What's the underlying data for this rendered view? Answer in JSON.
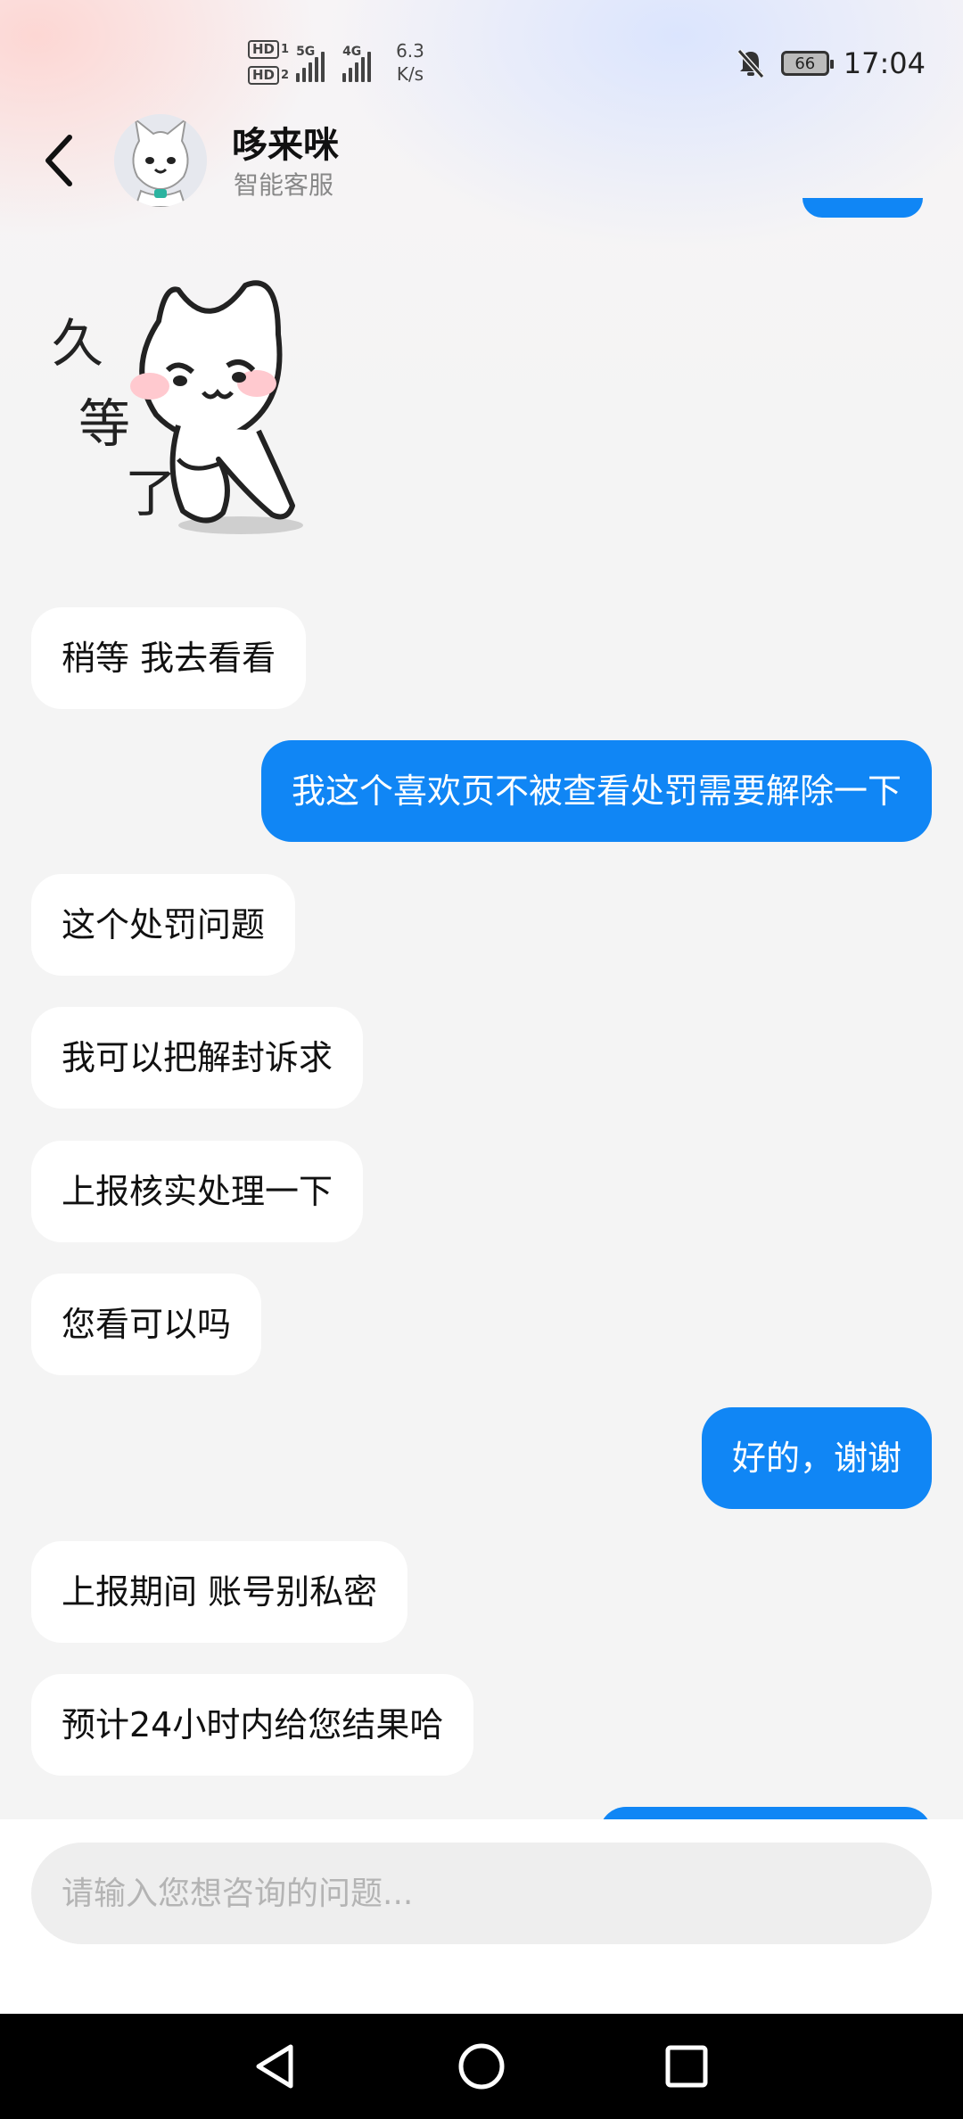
{
  "status_bar": {
    "sim1": "HD",
    "sim1_num": "1",
    "sim2": "HD",
    "sim2_num": "2",
    "net1": "5G",
    "net2": "4G",
    "speed_value": "6.3",
    "speed_unit": "K/s",
    "battery": "66",
    "time": "17:04",
    "icons": [
      "signal-5g-icon",
      "signal-4g-icon",
      "mute-bell-icon",
      "battery-icon"
    ]
  },
  "header": {
    "title": "哆来咪",
    "subtitle": "智能客服",
    "back_icon": "chevron-left-icon"
  },
  "chat": {
    "sticker": {
      "icon": "cat-waiting-sticker",
      "text_1": "久",
      "text_2": "等",
      "text_3": "了"
    },
    "messages": [
      {
        "side": "in",
        "text": "稍等 我去看看"
      },
      {
        "side": "out",
        "text": "我这个喜欢页不被查看处罚需要解除一下"
      },
      {
        "side": "in",
        "text": "这个处罚问题"
      },
      {
        "side": "in",
        "text": "我可以把解封诉求"
      },
      {
        "side": "in",
        "text": "上报核实处理一下"
      },
      {
        "side": "in",
        "text": "您看可以吗"
      },
      {
        "side": "out",
        "text": "好的，谢谢"
      },
      {
        "side": "in",
        "text": "上报期间 账号别私密"
      },
      {
        "side": "in",
        "text": "预计24小时内给您结果哈"
      }
    ]
  },
  "input": {
    "placeholder": "请输入您想咨询的问题..."
  },
  "nav": {
    "icons": [
      "nav-back-icon",
      "nav-home-icon",
      "nav-recents-icon"
    ]
  },
  "colors": {
    "accent": "#1086f5",
    "incoming_bubble": "#ffffff",
    "background": "#f4f4f4"
  }
}
